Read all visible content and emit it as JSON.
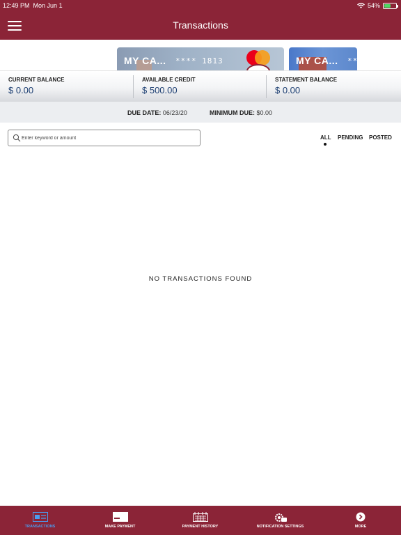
{
  "status_bar": {
    "time": "12:49 PM",
    "date": "Mon Jun 1",
    "battery": "54%"
  },
  "nav": {
    "title": "Transactions"
  },
  "cards": [
    {
      "name": "MY CA...",
      "masked_number": "**** 1813"
    },
    {
      "name": "MY CA...",
      "masked_number": "**"
    }
  ],
  "balances": {
    "current": {
      "label": "CURRENT BALANCE",
      "value": "$ 0.00"
    },
    "available": {
      "label": "AVAILABLE CREDIT",
      "value": "$ 500.00"
    },
    "statement": {
      "label": "STATEMENT BALANCE",
      "value": "$ 0.00"
    }
  },
  "due": {
    "due_date_label": "DUE DATE:",
    "due_date_value": "06/23/20",
    "min_due_label": "MINIMUM DUE:",
    "min_due_value": "$0.00"
  },
  "search": {
    "placeholder": "Enter keyword or amount",
    "value": ""
  },
  "filters": {
    "all": "ALL",
    "pending": "PENDING",
    "posted": "POSTED",
    "selected": "all"
  },
  "empty_message": "NO TRANSACTIONS FOUND",
  "tabs": {
    "transactions": "TRANSACTIONS",
    "make_payment": "MAKE PAYMENT",
    "payment_history": "PAYMENT HISTORY",
    "notification_settings": "NOTIFICATION SETTINGS",
    "more": "MORE",
    "active": "transactions"
  },
  "colors": {
    "brand": "#8b2437",
    "active_tab": "#4a9df0",
    "balance_text": "#1d3f72"
  },
  "icons": [
    "menu-icon",
    "wifi-icon",
    "battery-icon",
    "mastercard-icon",
    "search-icon",
    "transactions-icon",
    "make-payment-icon",
    "payment-history-icon",
    "notification-settings-icon",
    "more-icon"
  ]
}
